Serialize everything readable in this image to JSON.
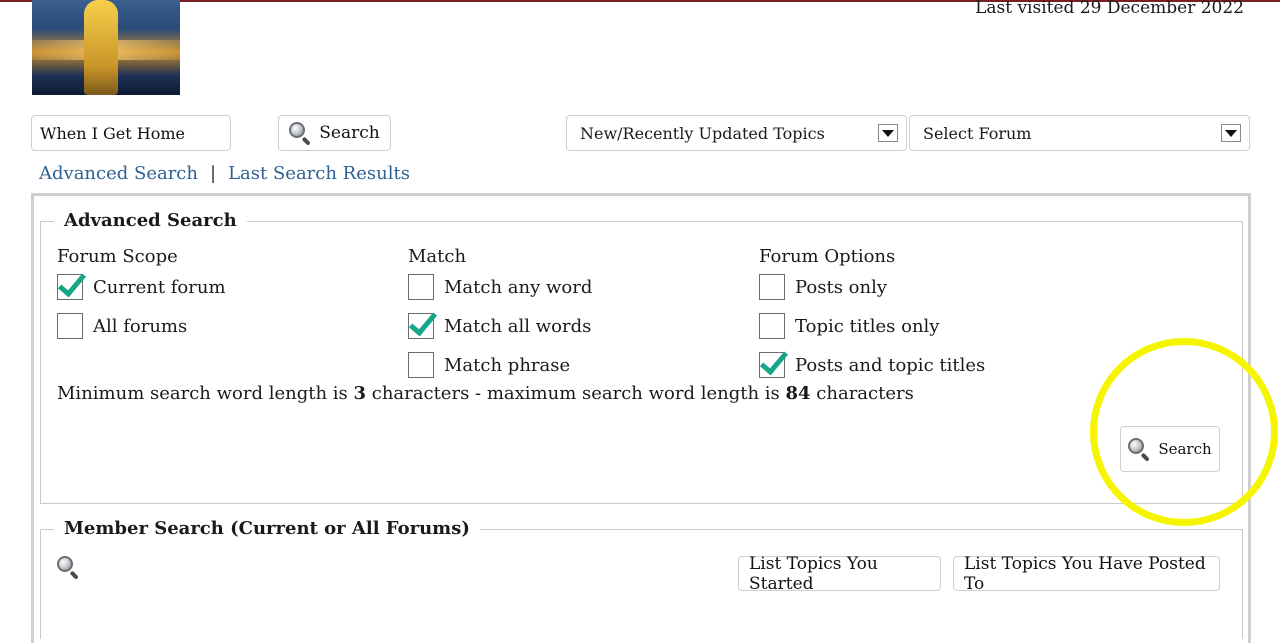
{
  "header": {
    "last_visited": "Last visited 29 December 2022"
  },
  "search": {
    "value": "When I Get Home",
    "button_label": "Search"
  },
  "selects": {
    "topics": "New/Recently Updated Topics",
    "forum": "Select Forum"
  },
  "links": {
    "advanced": "Advanced Search",
    "separator": "|",
    "last_results": "Last Search Results"
  },
  "advanced_search": {
    "legend": "Advanced Search",
    "forum_scope": {
      "heading": "Forum Scope",
      "options": [
        {
          "label": "Current forum",
          "checked": true
        },
        {
          "label": "All forums",
          "checked": false
        }
      ]
    },
    "match": {
      "heading": "Match",
      "options": [
        {
          "label": "Match any word",
          "checked": false
        },
        {
          "label": "Match all words",
          "checked": true
        },
        {
          "label": "Match phrase",
          "checked": false
        }
      ]
    },
    "forum_options": {
      "heading": "Forum Options",
      "options": [
        {
          "label": "Posts only",
          "checked": false
        },
        {
          "label": "Topic titles only",
          "checked": false
        },
        {
          "label": "Posts and topic titles",
          "checked": true
        }
      ]
    },
    "min_max": {
      "prefix": "Minimum search word length is ",
      "min": "3",
      "middle": " characters - maximum search word length is ",
      "max": "84",
      "suffix": " characters"
    },
    "search_button": "Search"
  },
  "member_search": {
    "legend": "Member Search (Current or All Forums)",
    "btn_started": "List Topics You Started",
    "btn_posted": "List Topics You Have Posted To"
  },
  "colors": {
    "link": "#2f5f93",
    "checkmark": "#17a589",
    "highlight": "#f5f500"
  }
}
